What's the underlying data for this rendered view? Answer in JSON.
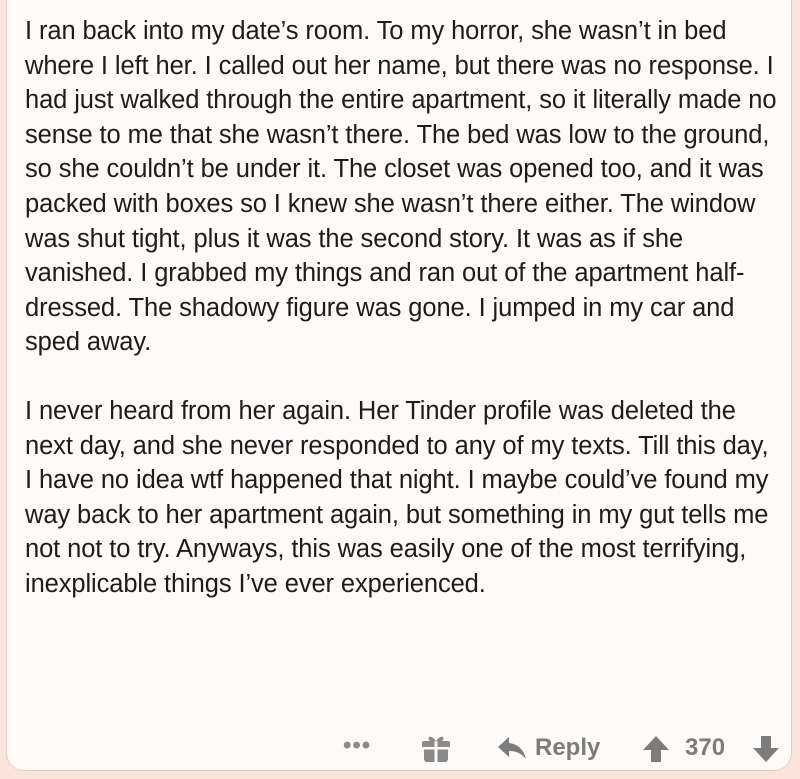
{
  "comment": {
    "paragraphs": [
      "I ran back into my date’s room. To my horror, she wasn’t in bed where I left her. I called out her name, but there was no response. I had just walked through the entire apartment, so it literally made no sense to me that she wasn’t there. The bed was low to the ground, so she couldn’t be under it. The closet was opened too, and it was packed with boxes so I knew she wasn’t there either. The window was shut tight, plus it was the second story. It was as if she vanished. I grabbed my things and ran out of the apartment half-dressed. The shadowy figure was gone. I jumped in my car and sped away.",
      "I never heard from her again. Her Tinder profile was deleted the next day, and she never responded to any of my texts. Till this day, I have no idea wtf happened that night. I maybe could’ve found my way back to her apartment again, but something in my gut tells me not not to try. Anyways, this was easily one of the most terrifying, inexplicable things I’ve ever experienced."
    ]
  },
  "actions": {
    "more_label": "•••",
    "gift_icon": "gift-icon",
    "reply_icon": "reply-arrow-icon",
    "reply_label": "Reply",
    "upvote_icon": "upvote-arrow-icon",
    "score": "370",
    "downvote_icon": "downvote-arrow-icon"
  },
  "colors": {
    "background": "#fbe4db",
    "card": "#fefaf8",
    "text": "#1c1c1c",
    "action_gray": "#7c7c7c"
  }
}
